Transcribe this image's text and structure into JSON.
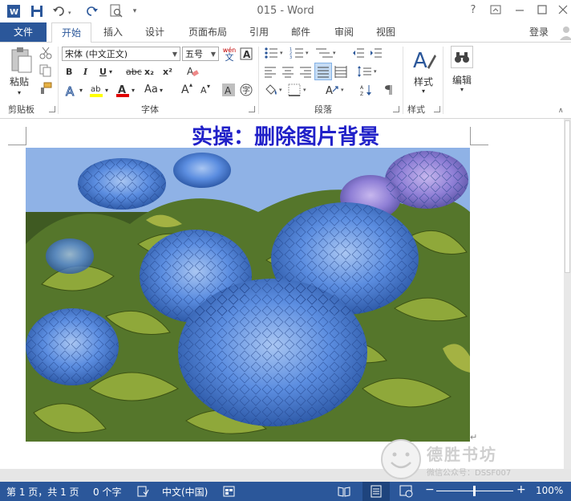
{
  "titlebar": {
    "title": "015 - Word",
    "help": "?"
  },
  "tabs": {
    "file": "文件",
    "items": [
      "开始",
      "插入",
      "设计",
      "页面布局",
      "引用",
      "邮件",
      "审阅",
      "视图"
    ],
    "login": "登录"
  },
  "ribbon": {
    "clipboard": {
      "paste": "粘贴",
      "label": "剪贴板"
    },
    "font": {
      "name": "宋体 (中文正文)",
      "size": "五号",
      "pinyin": "wén",
      "pinyin_char": "文",
      "bold": "B",
      "italic": "I",
      "underline": "U",
      "strike": "abc",
      "sub": "x₂",
      "sup": "x²",
      "grow": "A",
      "shrink": "A",
      "case": "Aa",
      "label": "字体"
    },
    "paragraph": {
      "label": "段落"
    },
    "styles": {
      "button": "样式",
      "label": "样式"
    },
    "editing": {
      "button": "编辑"
    }
  },
  "document": {
    "title": "实操：删除图片背景"
  },
  "watermark": {
    "name": "德胜书坊",
    "sub": "微信公众号：DSSF007"
  },
  "status": {
    "page": "第 1 页，共 1 页",
    "words": "0 个字",
    "lang": "中文(中国)",
    "zoom": "100%"
  },
  "colors": {
    "accent": "#2b579a",
    "title_text": "#2020c8"
  }
}
